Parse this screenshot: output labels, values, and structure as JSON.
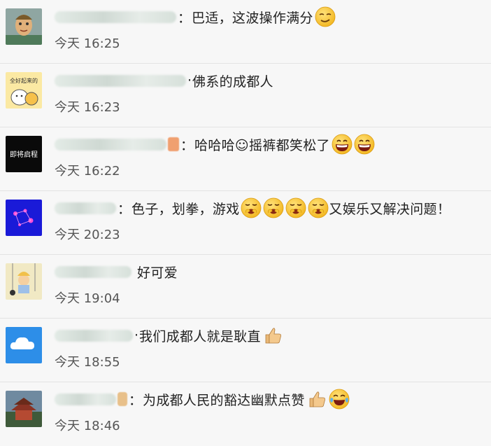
{
  "comments": [
    {
      "colon": "：",
      "text": "巴适，这波操作满分",
      "time": "今天 16:25",
      "emojis": [
        "smirk-emoji"
      ]
    },
    {
      "colon": "·",
      "text": "佛系的成都人",
      "time": "今天 16:23",
      "emojis": []
    },
    {
      "colon": "：",
      "text": "哈哈哈☺摇裤都笑松了",
      "time": "今天 16:22",
      "emojis": [
        "grin-emoji",
        "grin-emoji"
      ]
    },
    {
      "colon": "：",
      "text": "色子，划拳，游戏",
      "text2": "又娱乐又解决问题！",
      "time": "今天 20:23",
      "emojis": [
        "giggle-emoji",
        "giggle-emoji",
        "giggle-emoji",
        "giggle-emoji"
      ]
    },
    {
      "colon": "",
      "text": "好可爱",
      "time": "今天 19:04",
      "emojis": []
    },
    {
      "colon": "·",
      "text": "我们成都人就是耿直",
      "time": "今天 18:55",
      "emojis": [
        "thumbs-up-emoji"
      ]
    },
    {
      "colon": "：",
      "text": "为成都人民的豁达幽默点赞",
      "time": "今天 18:46",
      "emojis": [
        "thumbs-up-emoji",
        "joy-emoji"
      ]
    }
  ],
  "avatar_texts": {
    "a2": "全好起来的",
    "a3": "即将启程"
  },
  "colors": {
    "background": "#f7f7f7",
    "divider": "#e3e3e3",
    "time": "#555555",
    "emoji_yellow": "#f7c531"
  }
}
